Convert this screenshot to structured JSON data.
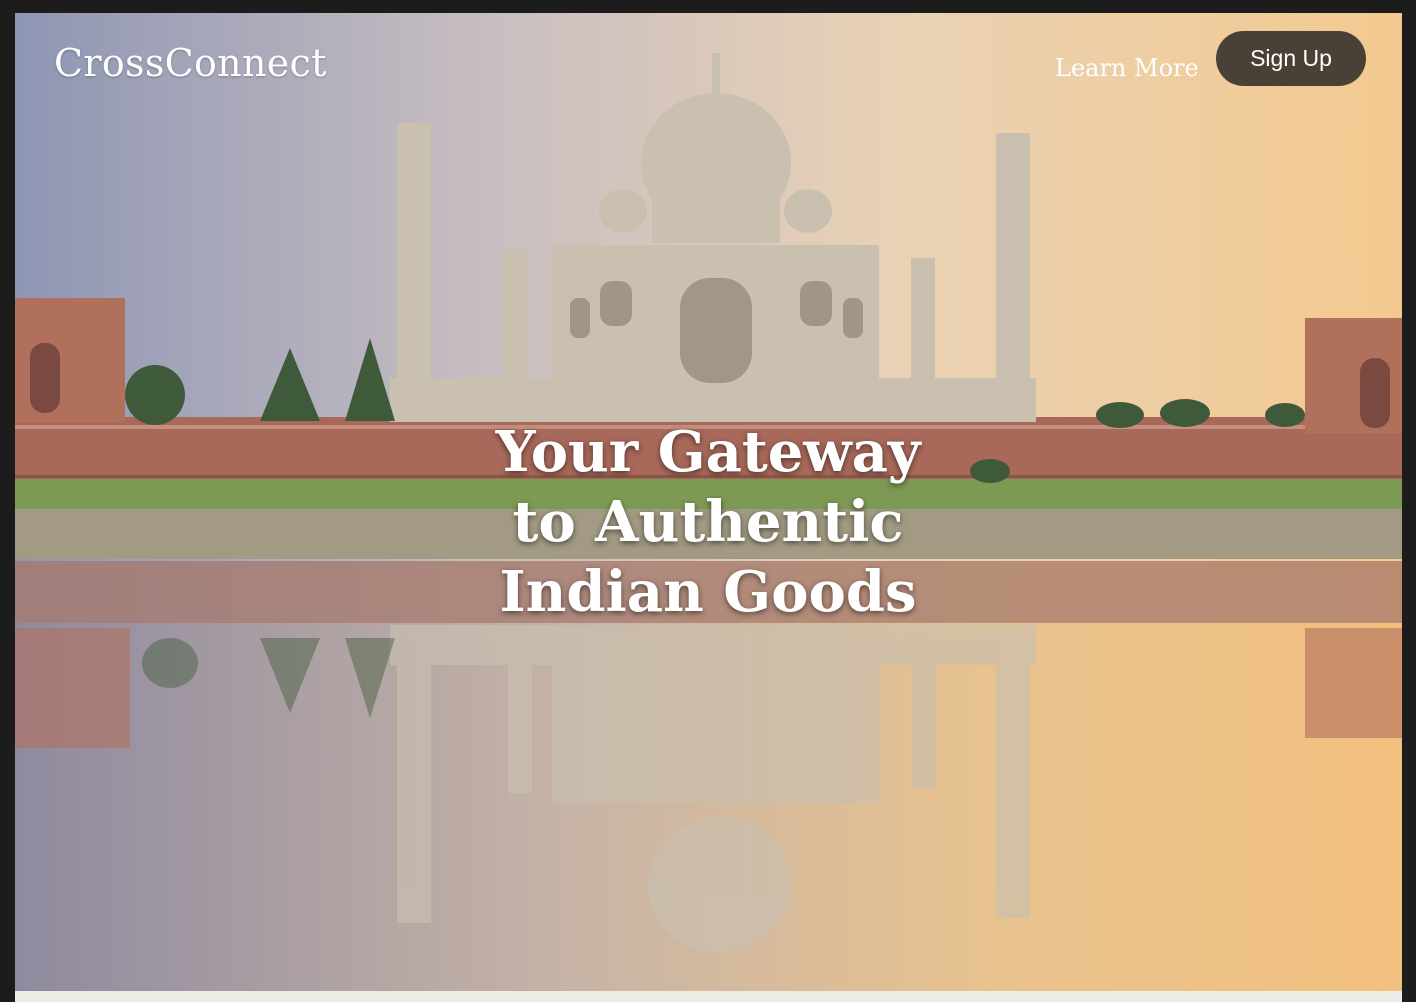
{
  "header": {
    "brand": "CrossConnect",
    "learn_more_label": "Learn More",
    "signup_label": "Sign Up"
  },
  "hero": {
    "headline_lines": [
      "Your Gateway",
      "to Authentic",
      "Indian Goods"
    ],
    "image_subject": "taj-mahal-reflection"
  },
  "colors": {
    "signup_bg": "#4a4136",
    "text": "#ffffff",
    "frame_bg": "#1c1c1c",
    "bottom_strip": "#ecebe6"
  }
}
